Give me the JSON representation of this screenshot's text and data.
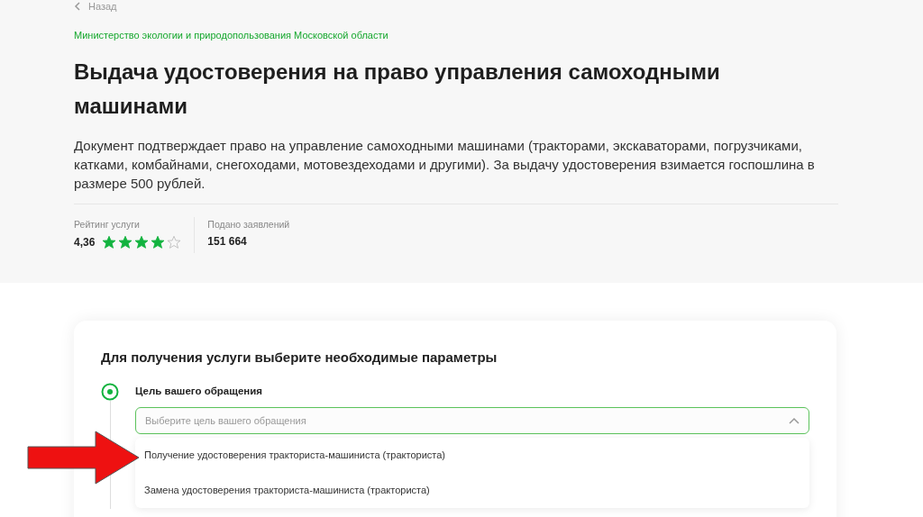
{
  "back_link": "Назад",
  "ministry": "Министерство экологии и природопользования Московской области",
  "title": "Выдача удостоверения на право управления самоходными машинами",
  "description": "Документ подтверждает право на управление самоходными машинами (тракторами, экскаваторами, погрузчиками, катками, комбайнами, снегоходами, мотовездеходами и другими). За выдачу удостоверения взимается госпошлина в размере 500 рублей.",
  "rating": {
    "label": "Рейтинг услуги",
    "value": "4,36",
    "stars": 4
  },
  "applications": {
    "label": "Подано заявлений",
    "value": "151 664"
  },
  "form": {
    "heading": "Для получения услуги выберите необходимые параметры",
    "step": {
      "label": "Цель вашего обращения",
      "active": true,
      "select": {
        "placeholder": "Выберите цель вашего обращения",
        "expanded": true,
        "options": [
          {
            "label": "Получение удостоверения тракториста-машиниста (тракториста)",
            "highlighted": true
          },
          {
            "label": "Замена удостоверения тракториста-машиниста (тракториста)",
            "highlighted": false
          }
        ]
      }
    }
  }
}
